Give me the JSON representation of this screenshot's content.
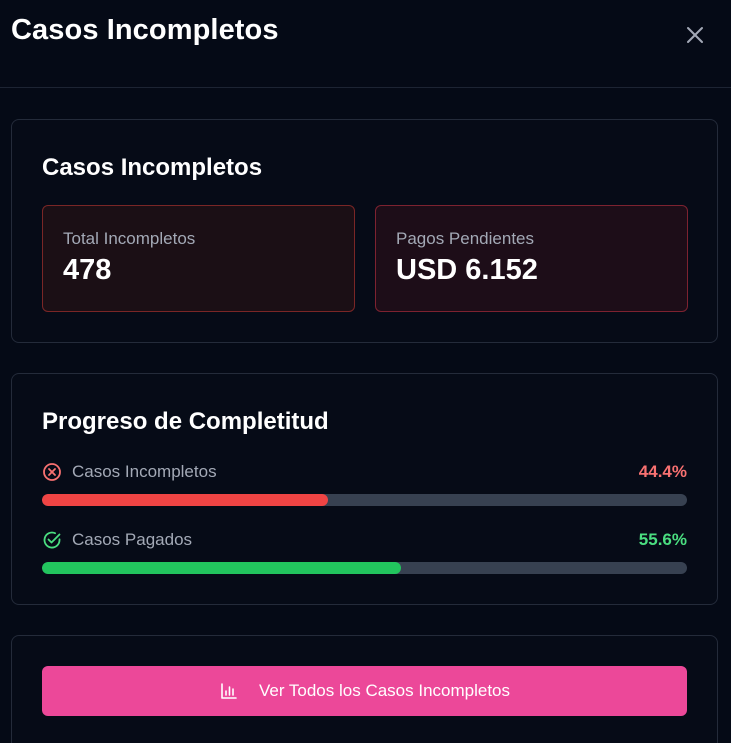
{
  "modal": {
    "title": "Casos Incompletos",
    "close_icon": "close-icon"
  },
  "summary": {
    "title": "Casos Incompletos",
    "total_label": "Total Incompletos",
    "total_value": "478",
    "pending_label": "Pagos Pendientes",
    "pending_value": "USD 6.152"
  },
  "progress": {
    "title": "Progreso de Completitud",
    "rows": [
      {
        "label": "Casos Incompletos",
        "percent_text": "44.4%",
        "percent": 44.4,
        "icon": "x-circle-icon",
        "color": "#ef4444"
      },
      {
        "label": "Casos Pagados",
        "percent_text": "55.6%",
        "percent": 55.6,
        "icon": "check-circle-icon",
        "color": "#22c55e"
      }
    ]
  },
  "action": {
    "button_label": "Ver Todos los Casos Incompletos",
    "button_icon": "bar-chart-icon",
    "color": "#ec4899"
  }
}
